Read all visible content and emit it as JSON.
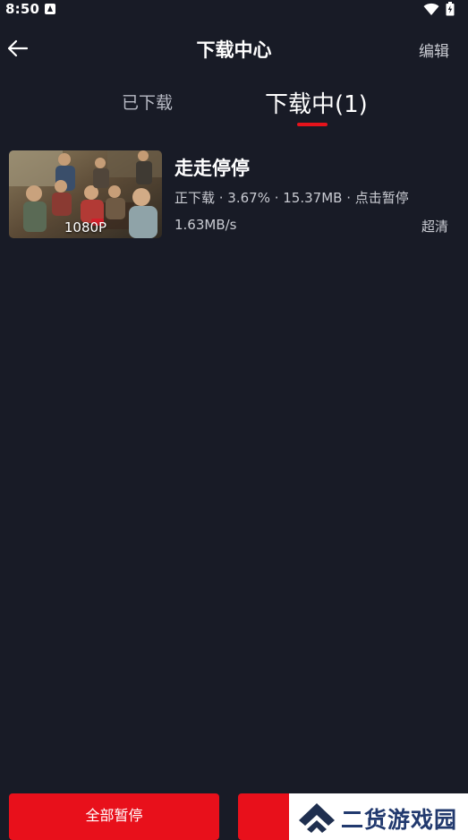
{
  "status_bar": {
    "time": "8:50",
    "app_icon": "notification-a-icon",
    "wifi_icon": "wifi-icon",
    "battery_icon": "battery-icon"
  },
  "header": {
    "back_icon": "arrow-left-icon",
    "title": "下载中心",
    "edit_label": "编辑"
  },
  "tabs": [
    {
      "label": "已下载",
      "active": false
    },
    {
      "label": "下载中(1)",
      "active": true
    }
  ],
  "downloads": [
    {
      "title": "走走停停",
      "quality": "1080P",
      "status_line": "正下载 · 3.67% · 15.37MB · 点击暂停",
      "progress_percent": 3.67,
      "speed": "1.63MB/s",
      "definition": "超清"
    }
  ],
  "bottom": {
    "pause_all_label": "全部暂停",
    "second_button_label": ""
  },
  "watermark": {
    "text": "二货游戏园",
    "logo": "chevron-up-logo"
  },
  "colors": {
    "background": "#181b26",
    "accent_red": "#e8101b",
    "tab_indicator": "#e5131b",
    "watermark_text": "#21396e"
  }
}
